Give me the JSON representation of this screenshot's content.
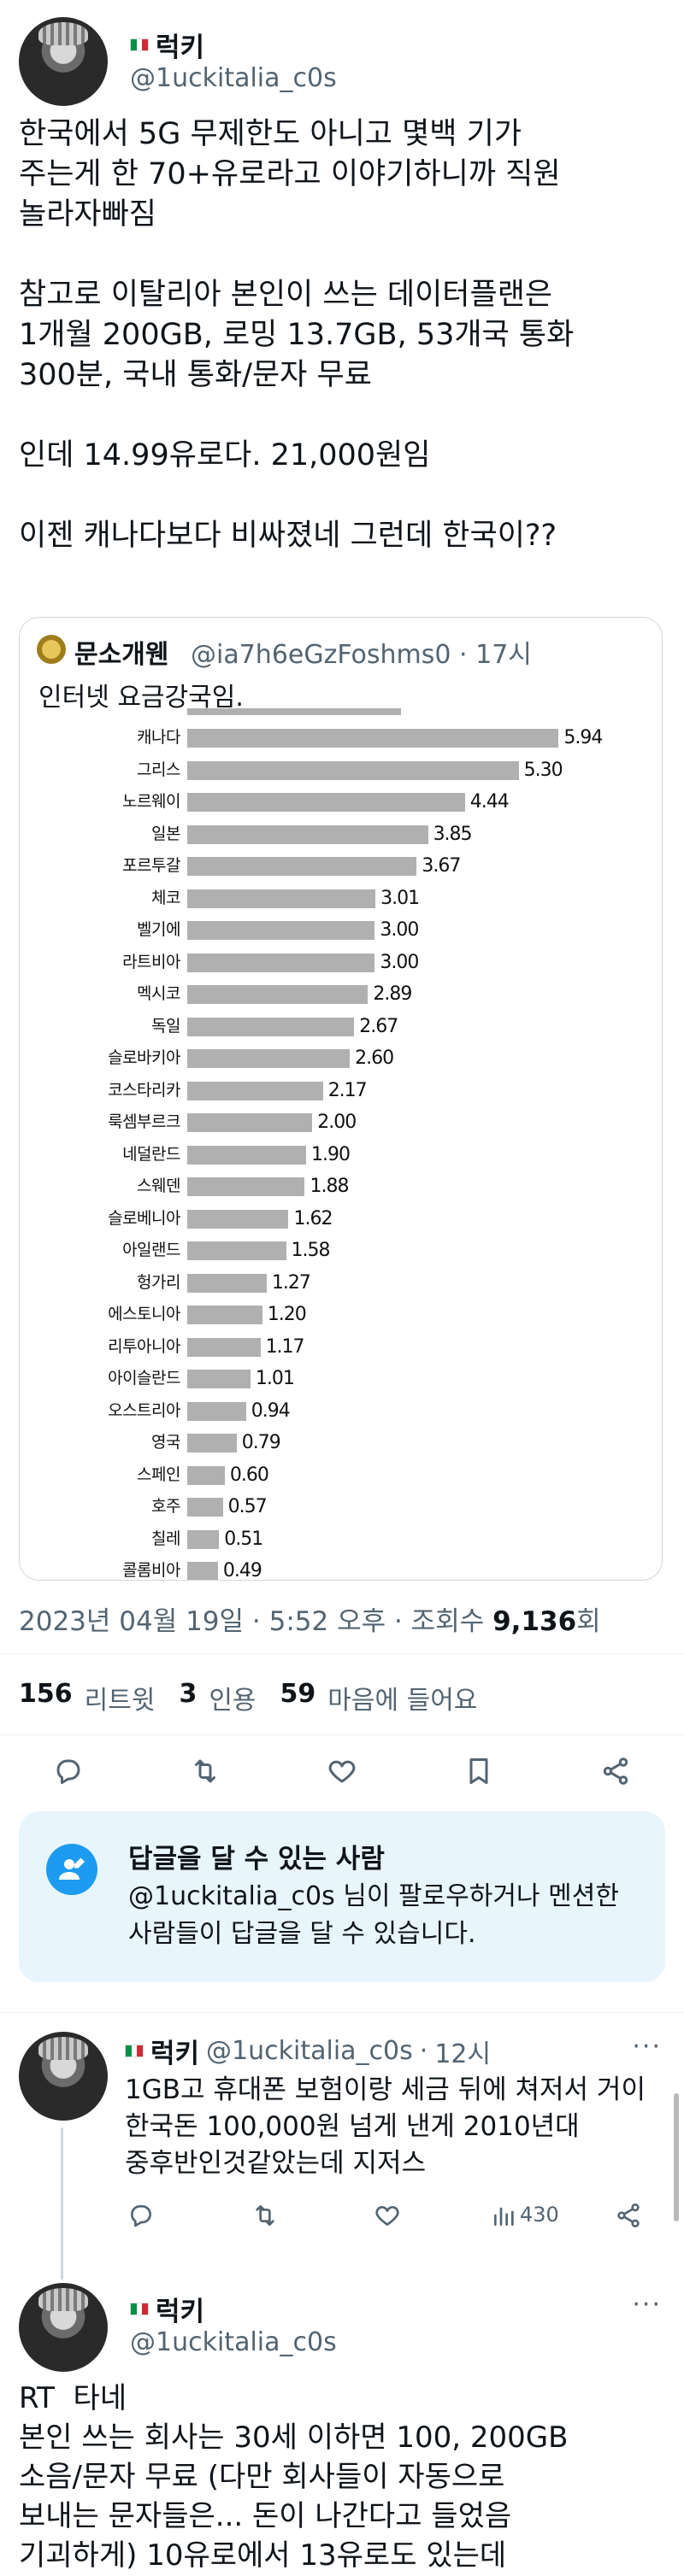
{
  "main_tweet": {
    "display_name": "럭키",
    "handle": "@1uckitalia_c0s",
    "text": "한국에서 5G 무제한도 아니고 몇백 기가\n주는게 한 70+유로라고 이야기하니까 직원\n놀라자빠짐\n\n참고로 이탈리아 본인이 쓰는 데이터플랜은\n1개월 200GB, 로밍 13.7GB, 53개국 통화\n300분, 국내 통화/문자 무료\n\n인데 14.99유로다. 21,000원임\n\n이젠 캐나다보다 비싸졌네 그런데 한국이??",
    "flag_colors": [
      "#009246",
      "#ffffff",
      "#ce2b37"
    ]
  },
  "quote": {
    "display_name": "문소개웬",
    "handle": "@ia7h6eGzFoshms0",
    "time": "17시",
    "text": "인터넷 요금강국임."
  },
  "chart_data": {
    "type": "bar",
    "orientation": "horizontal",
    "categories": [
      "캐나다",
      "그리스",
      "노르웨이",
      "일본",
      "포르투갈",
      "체코",
      "벨기에",
      "라트비아",
      "멕시코",
      "독일",
      "슬로바키아",
      "코스타리카",
      "룩셈부르크",
      "네덜란드",
      "스웨덴",
      "슬로베니아",
      "아일랜드",
      "헝가리",
      "에스토니아",
      "리투아니아",
      "아이슬란드",
      "오스트리아",
      "영국",
      "스페인",
      "호주",
      "칠레",
      "콜롬비아"
    ],
    "values": [
      5.94,
      5.3,
      4.44,
      3.85,
      3.67,
      3.01,
      3.0,
      3.0,
      2.89,
      2.67,
      2.6,
      2.17,
      2.0,
      1.9,
      1.88,
      1.62,
      1.58,
      1.27,
      1.2,
      1.17,
      1.01,
      0.94,
      0.79,
      0.6,
      0.57,
      0.51,
      0.49
    ],
    "value_labels": [
      "5.94",
      "5.30",
      "4.44",
      "3.85",
      "3.67",
      "3.01",
      "3.00",
      "3.00",
      "2.89",
      "2.67",
      "2.60",
      "2.17",
      "2.00",
      "1.90",
      "1.88",
      "1.62",
      "1.58",
      "1.27",
      "1.20",
      "1.17",
      "1.01",
      "0.94",
      "0.79",
      "0.60",
      "0.57",
      "0.51",
      "0.49"
    ],
    "bar_color": "#b0b0b0",
    "xlim": [
      0,
      6.7
    ],
    "note": "top row partially cropped"
  },
  "meta": {
    "datetime": "2023년 04월 19일 · 5:52 오후 · 조회수",
    "views": "9,136",
    "views_suffix": "회"
  },
  "stats": {
    "retweets": "156",
    "retweets_label": "리트윗",
    "quotes": "3",
    "quotes_label": "인용",
    "likes": "59",
    "likes_label": "마음에 들어요"
  },
  "actions": [
    "reply-icon",
    "retweet-icon",
    "like-icon",
    "bookmark-icon",
    "share-icon"
  ],
  "notice": {
    "title": "답글을 달 수 있는 사람",
    "body": "@1uckitalia_c0s 님이 팔로우하거나 멘션한 사람들이 답글을 달 수 있습니다.",
    "accent": "#1d9bf0"
  },
  "reply1": {
    "display_name": "럭키",
    "handle": "@1uckitalia_c0s",
    "time": "12시",
    "text": "1GB고 휴대폰 보험이랑 세금 뒤에 쳐저서 거이\n한국돈 100,000원 넘게 낸게 2010년대\n중후반인것같았는데 지저스",
    "views": "430",
    "more": "···"
  },
  "reply2": {
    "display_name": "럭키",
    "handle": "@1uckitalia_c0s",
    "text": "RT  타네\n본인 쓰는 회사는 30세 이하면 100, 200GB\n소음/문자 무료 (다만 회사들이 자동으로\n보내는 문자들은... 돈이 나간다고 들었음\n기괴하게) 10유로에서 13유로도 있는데",
    "more": "···"
  }
}
